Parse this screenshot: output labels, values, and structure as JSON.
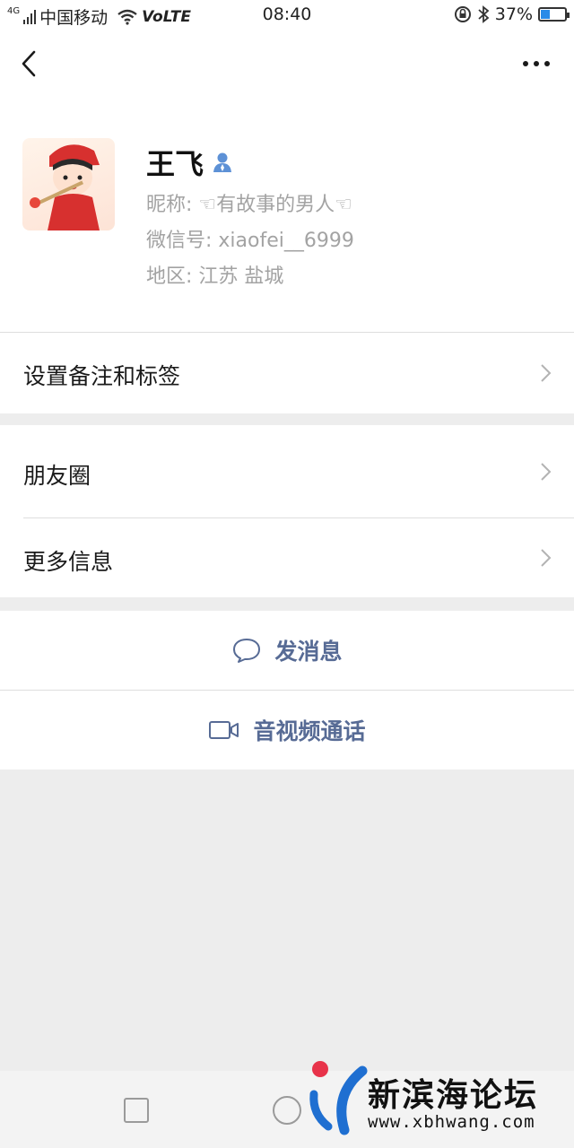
{
  "status_bar": {
    "network_type": "4G",
    "carrier": "中国移动",
    "volte": "VoLTE",
    "time": "08:40",
    "battery_percent_label": "37%",
    "battery_level": 0.37
  },
  "profile": {
    "name": "王飞",
    "nickname": "昵称: ☜有故事的男人☜",
    "wechat_id": "微信号: xiaofei__6999",
    "region": "地区: 江苏  盐城"
  },
  "menu": {
    "remarks_label": "设置备注和标签",
    "moments_label": "朋友圈",
    "more_info_label": "更多信息"
  },
  "actions": {
    "message_label": "发消息",
    "call_label": "音视频通话"
  },
  "watermark": {
    "title": "新滨海论坛",
    "url": "www.xbhwang.com"
  },
  "colors": {
    "link": "#576b95",
    "background": "#ededed",
    "accent_red": "#e8334a",
    "accent_blue": "#1f6fd1"
  }
}
